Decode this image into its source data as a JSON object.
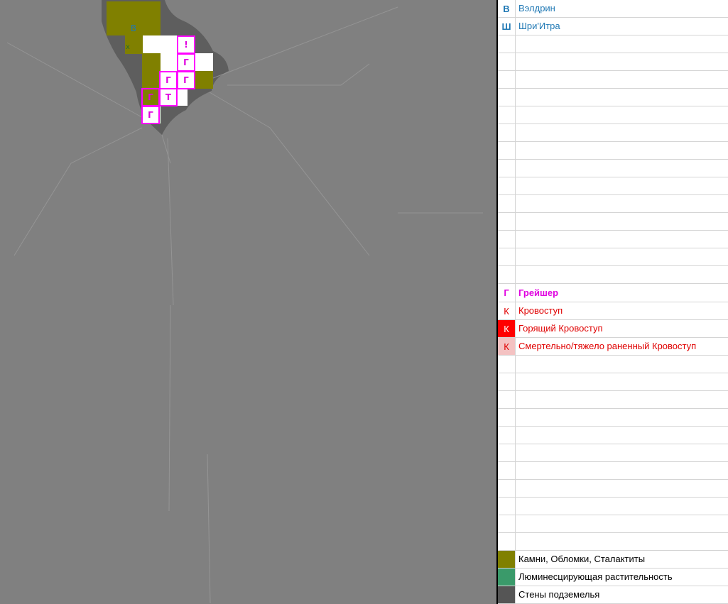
{
  "legend": {
    "characters": [
      {
        "symbol": "В",
        "name": "Вэлдрин"
      },
      {
        "symbol": "Ш",
        "name": "Шри'Итра"
      }
    ],
    "enemies": [
      {
        "symbol": "Г",
        "name": "Грейшер",
        "color": "#e000e0"
      },
      {
        "symbol": "К",
        "name": "Кровоступ",
        "color": "#e00000"
      },
      {
        "symbol": "К",
        "name": "Горящий Кровоступ",
        "color": "#e00000",
        "fill": "#ff0000"
      },
      {
        "symbol": "К",
        "name": "Смертельно/тяжело раненный Кровоступ",
        "color": "#e00000",
        "fill": "#f4c2c2"
      }
    ],
    "terrain": [
      {
        "name": "Камни, Обломки, Сталактиты",
        "color": "#808000"
      },
      {
        "name": "Люминесцирующая растительность",
        "color": "#3a9a6a"
      },
      {
        "name": "Стены подземелья",
        "color": "#555555"
      }
    ]
  },
  "map": {
    "tokens": {
      "veldrin": "В",
      "marker_x": "х",
      "alert": "!",
      "greisher": "Г",
      "t_marker": "Т"
    }
  }
}
